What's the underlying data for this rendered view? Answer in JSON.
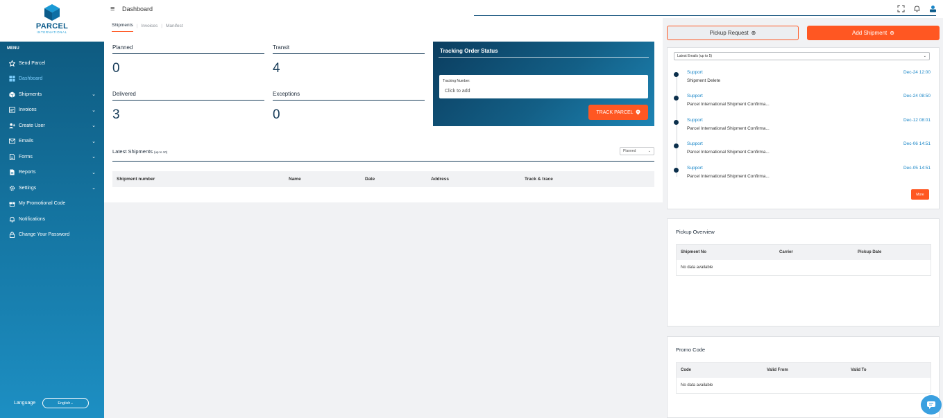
{
  "brand": {
    "name": "PARCEL",
    "sub": "INTERNATIONAL"
  },
  "sidebar": {
    "menu_label": "MENU",
    "items": [
      {
        "label": "Send Parcel",
        "icon": "star-icon",
        "chevron": false
      },
      {
        "label": "Dashboard",
        "icon": "grid-icon",
        "chevron": false,
        "active": true
      },
      {
        "label": "Shipments",
        "icon": "box-icon",
        "chevron": true
      },
      {
        "label": "Invoices",
        "icon": "invoice-icon",
        "chevron": true
      },
      {
        "label": "Create User",
        "icon": "user-plus-icon",
        "chevron": true
      },
      {
        "label": "Emails",
        "icon": "mail-icon",
        "chevron": true
      },
      {
        "label": "Forms",
        "icon": "file-icon",
        "chevron": true
      },
      {
        "label": "Reports",
        "icon": "report-icon",
        "chevron": true
      },
      {
        "label": "Settings",
        "icon": "gear-icon",
        "chevron": true
      },
      {
        "label": "My Promotional Code",
        "icon": "gift-icon",
        "chevron": false
      },
      {
        "label": "Notifications",
        "icon": "bell-icon",
        "chevron": false
      },
      {
        "label": "Change Your Password",
        "icon": "lock-icon",
        "chevron": false
      }
    ],
    "language_label": "Language",
    "language_value": "English"
  },
  "topbar": {
    "title": "Dashboard"
  },
  "tabs": [
    {
      "label": "Shipments",
      "active": true
    },
    {
      "label": "Invoices",
      "active": false
    },
    {
      "label": "Manifest",
      "active": false
    }
  ],
  "stats": [
    {
      "label": "Planned",
      "value": "0"
    },
    {
      "label": "Transit",
      "value": "4"
    },
    {
      "label": "Delivered",
      "value": "3"
    },
    {
      "label": "Exceptions",
      "value": "0"
    }
  ],
  "tracking": {
    "title": "Tracking Order Status",
    "input_label": "Tracking Number:",
    "input_placeholder": "Click to add",
    "button": "TRACK PARCEL"
  },
  "latest_shipments": {
    "title": "Latest Shipments",
    "note": "(up to 10)",
    "filter": "Planned",
    "columns": [
      "Shipment number",
      "Name",
      "Date",
      "Address",
      "Track & trace"
    ]
  },
  "actions": {
    "pickup": "Pickup Request",
    "add": "Add Shipment"
  },
  "emails": {
    "filter": "Latest Emails (up to 5)",
    "items": [
      {
        "from": "Support",
        "date": "Dec-24 12:00",
        "subject": "Shipment Delete"
      },
      {
        "from": "Support",
        "date": "Dec-24 08:50",
        "subject": "Parcel International Shipment Confirma..."
      },
      {
        "from": "Support",
        "date": "Dec-12 08:01",
        "subject": "Parcel International Shipment Confirma..."
      },
      {
        "from": "Support",
        "date": "Dec-06 14:51",
        "subject": "Parcel International Shipment Confirma..."
      },
      {
        "from": "Support",
        "date": "Dec-05 14:51",
        "subject": "Parcel International Shipment Confirma..."
      }
    ],
    "more": "More"
  },
  "pickup_overview": {
    "title": "Pickup Overview",
    "columns": [
      "Shipment No",
      "Carrier",
      "Pickup Date"
    ],
    "empty": "No data available"
  },
  "promo": {
    "title": "Promo Code",
    "columns": [
      "Code",
      "Valid From",
      "Valid To"
    ],
    "empty": "No data available"
  },
  "colors": {
    "accent": "#ff5722",
    "primary": "#0d5579",
    "link": "#1a86c7"
  }
}
